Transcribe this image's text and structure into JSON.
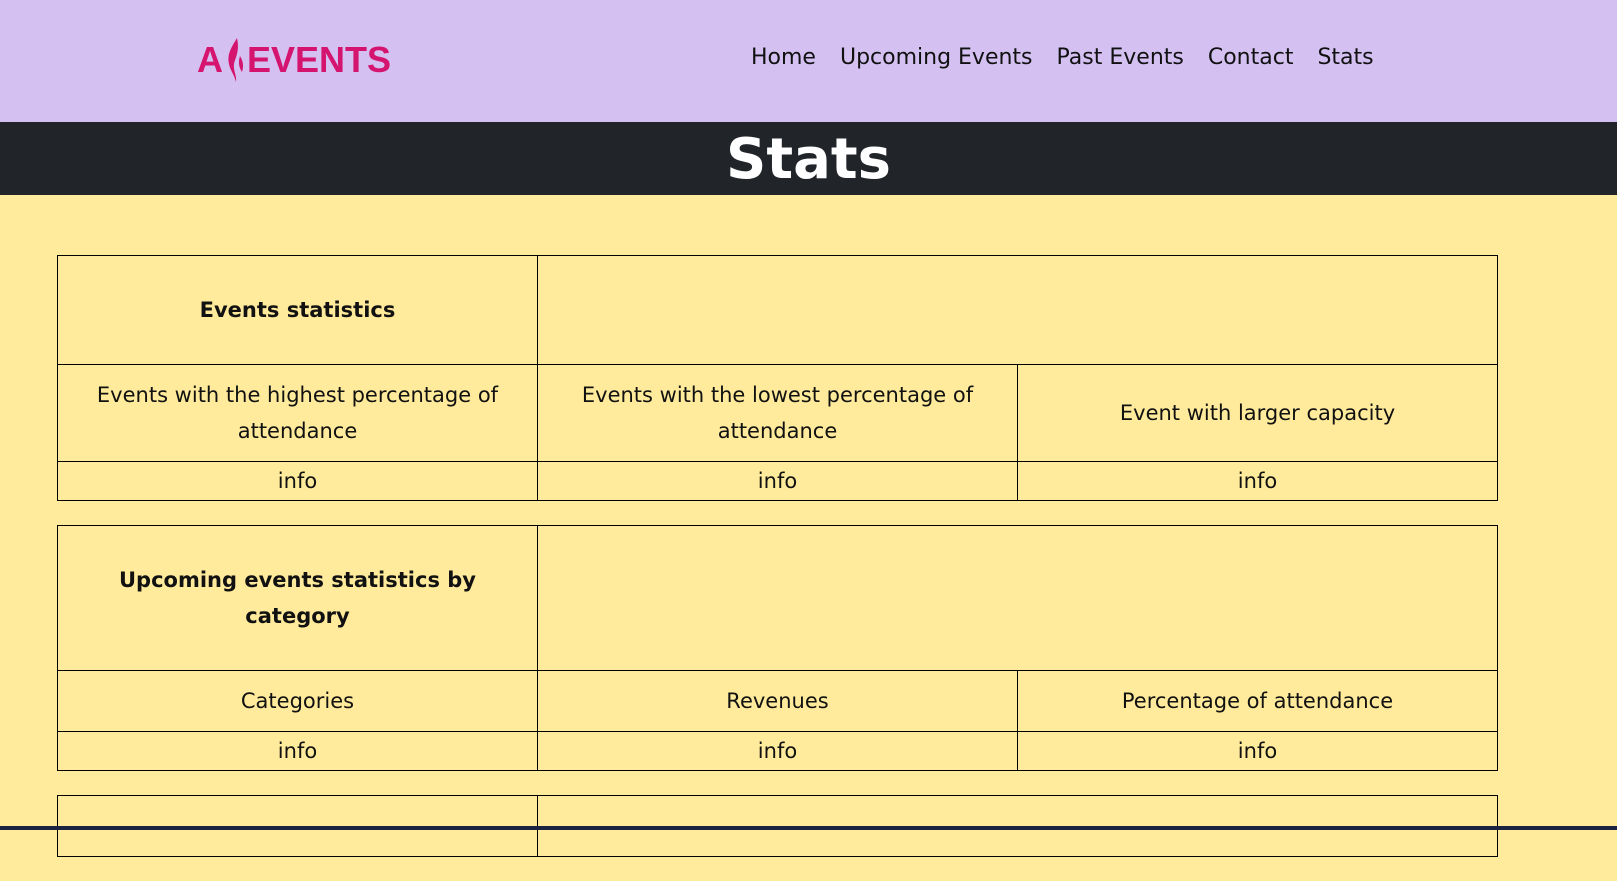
{
  "brand": {
    "logo_left": "A",
    "logo_right": "EVENTS",
    "color": "#d4146f"
  },
  "nav": {
    "items": [
      {
        "label": "Home"
      },
      {
        "label": "Upcoming Events"
      },
      {
        "label": "Past Events"
      },
      {
        "label": "Contact"
      },
      {
        "label": "Stats"
      }
    ]
  },
  "page": {
    "title": "Stats"
  },
  "tables": {
    "events": {
      "header": "Events statistics",
      "columns": [
        "Events with the highest percentage of attendance",
        "Events with the lowest percentage of attendance",
        "Event with larger capacity"
      ],
      "values": [
        "info",
        "info",
        "info"
      ]
    },
    "upcoming": {
      "header": "Upcoming events statistics by category",
      "columns": [
        "Categories",
        "Revenues",
        "Percentage of attendance"
      ],
      "values": [
        "info",
        "info",
        "info"
      ]
    }
  },
  "colors": {
    "navbar_bg": "#d4c1f2",
    "banner_bg": "#212429",
    "page_bg": "#ffeb9b"
  }
}
